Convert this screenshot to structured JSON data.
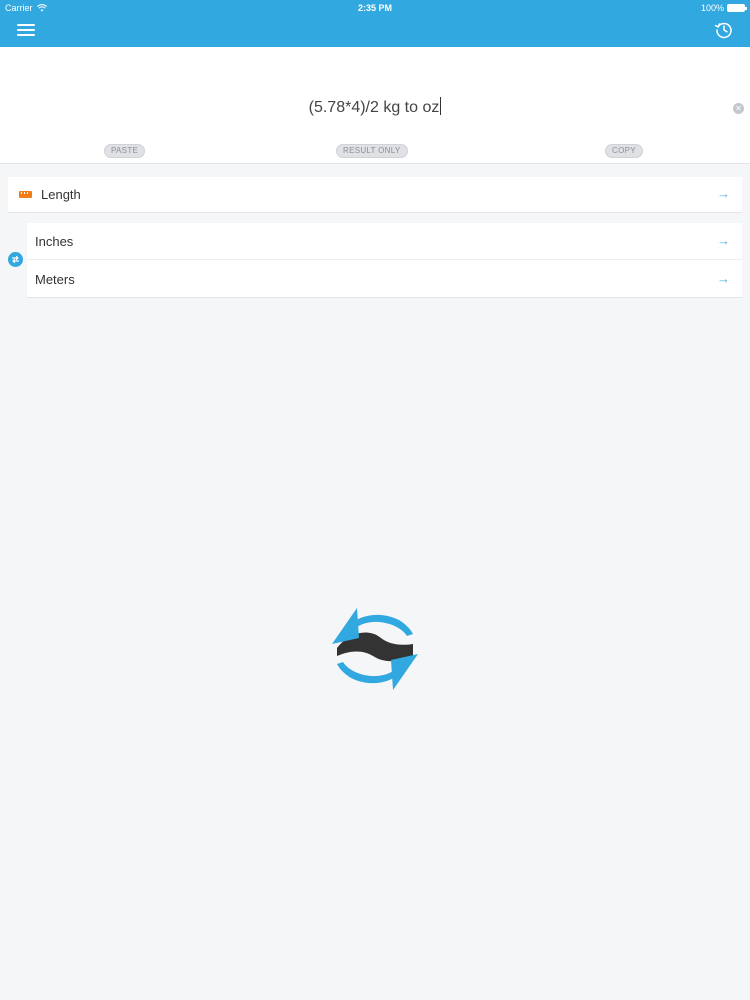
{
  "status_bar": {
    "carrier": "Carrier",
    "time": "2:35 PM",
    "battery": "100%"
  },
  "nav": {
    "menu_icon": "hamburger-icon",
    "history_icon": "history-clock-icon"
  },
  "input": {
    "expression": "(5.78*4)/2 kg to oz",
    "clear_icon": "clear-x-icon"
  },
  "actions": {
    "paste": "PASTE",
    "result_only": "RESULT ONLY",
    "copy": "COPY"
  },
  "category": {
    "label": "Length",
    "icon": "ruler-icon"
  },
  "units": [
    {
      "label": "Inches"
    },
    {
      "label": "Meters"
    }
  ],
  "colors": {
    "accent": "#32a8e0",
    "category_icon": "#f07d16",
    "logo_dark": "#333333"
  },
  "logo_icon": "convert-arrows-icon"
}
